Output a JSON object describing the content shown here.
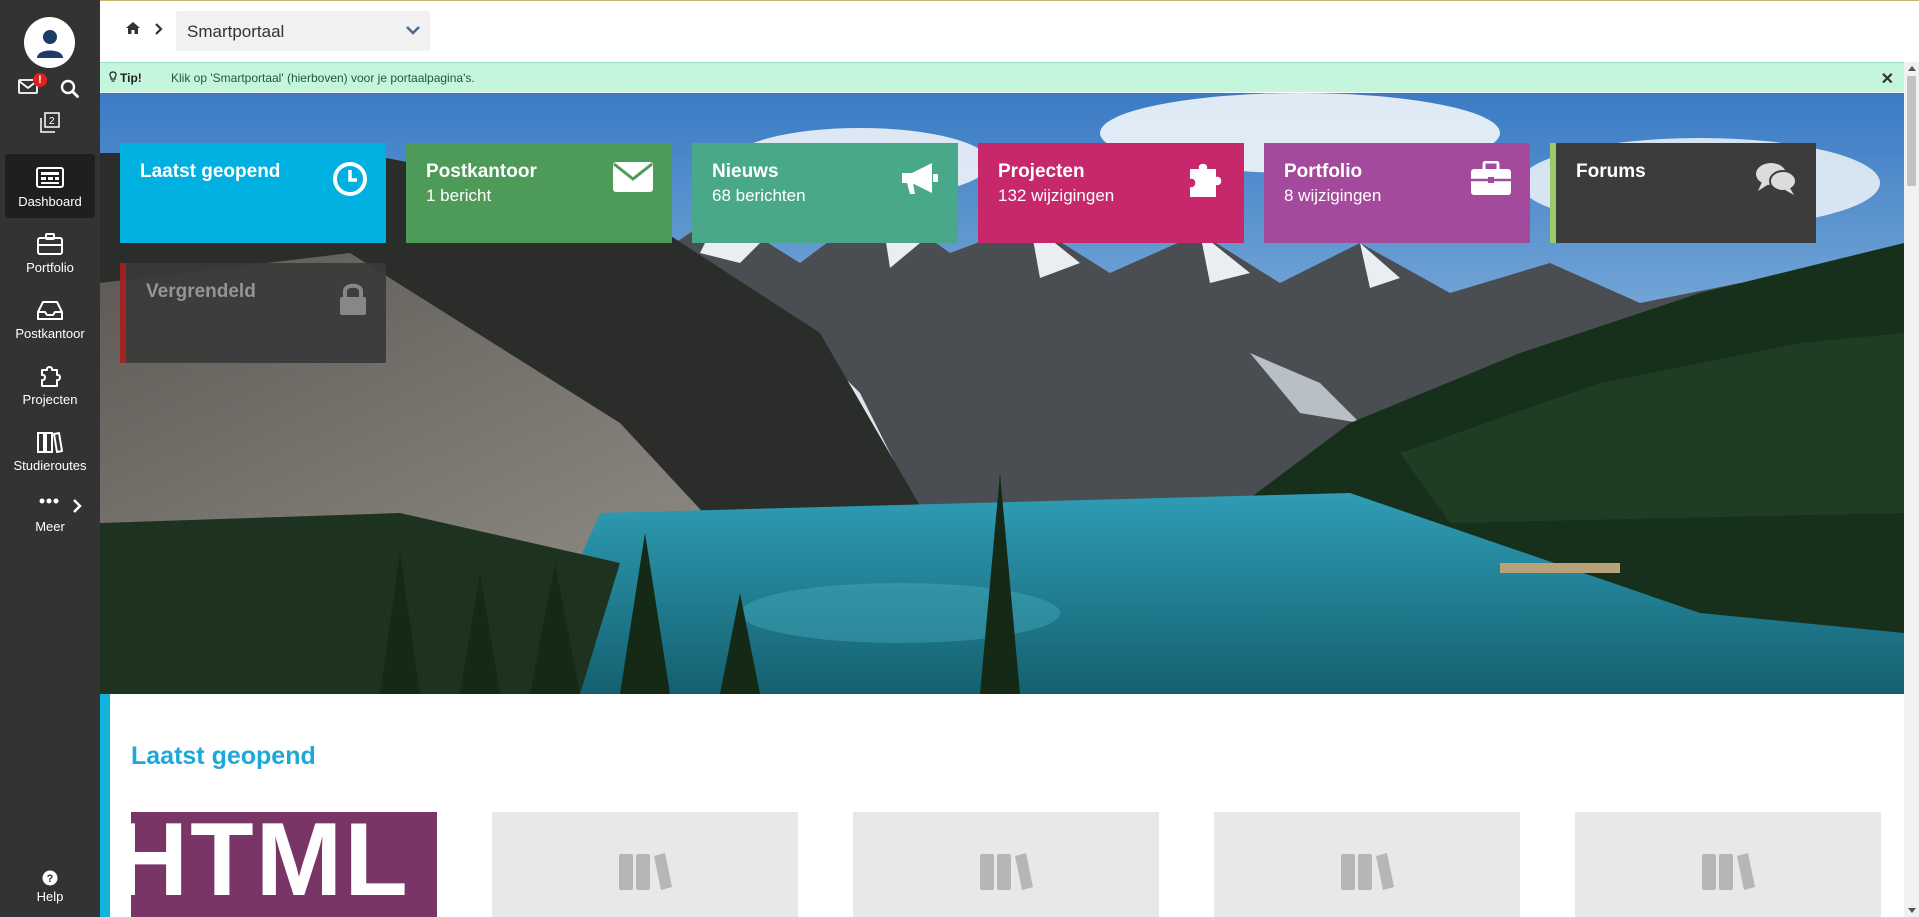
{
  "sidebar": {
    "mail_badge": "!",
    "windows_count": "2",
    "items": [
      {
        "label": "Dashboard",
        "icon": "dashboard-icon",
        "active": true
      },
      {
        "label": "Portfolio",
        "icon": "briefcase-icon"
      },
      {
        "label": "Postkantoor",
        "icon": "inbox-icon"
      },
      {
        "label": "Projecten",
        "icon": "puzzle-icon"
      },
      {
        "label": "Studieroutes",
        "icon": "books-icon"
      }
    ],
    "more_label": "Meer",
    "help_label": "Help"
  },
  "topbar": {
    "portal_select": "Smartportaal"
  },
  "tip": {
    "label": "Tip!",
    "text": "Klik op 'Smartportaal' (hierboven) voor je portaalpagina's."
  },
  "tiles": [
    {
      "title": "Laatst geopend",
      "subtitle": "",
      "icon": "clock-icon",
      "color": "#00b0e0"
    },
    {
      "title": "Postkantoor",
      "subtitle": "1 bericht",
      "icon": "envelope-icon",
      "color": "#4d9a59"
    },
    {
      "title": "Nieuws",
      "subtitle": "68 berichten",
      "icon": "megaphone-icon",
      "color": "#4aa88a"
    },
    {
      "title": "Projecten",
      "subtitle": "132 wijzigingen",
      "icon": "puzzle-icon",
      "color": "#c7286b"
    },
    {
      "title": "Portfolio",
      "subtitle": "8 wijzigingen",
      "icon": "briefcase-icon",
      "color": "#a44a9c"
    },
    {
      "title": "Forums",
      "subtitle": "",
      "icon": "comments-icon",
      "color": "#3c3c3c",
      "accent": "#9bc96b"
    },
    {
      "title": "Vergrendeld",
      "subtitle": "",
      "icon": "lock-icon",
      "color": "#3a3a3a",
      "accent": "#a82020"
    }
  ],
  "recent": {
    "heading": "Laatst geopend",
    "cards": [
      {
        "type": "image",
        "image_text": "HTML"
      },
      {
        "type": "placeholder",
        "icon": "books-icon"
      },
      {
        "type": "placeholder",
        "icon": "books-icon"
      },
      {
        "type": "placeholder",
        "icon": "books-icon"
      },
      {
        "type": "placeholder",
        "icon": "books-icon"
      }
    ]
  },
  "colors": {
    "sidebar_bg": "#333333",
    "tip_bg": "#c3f6dd",
    "heading_accent": "#1ca8d8"
  }
}
